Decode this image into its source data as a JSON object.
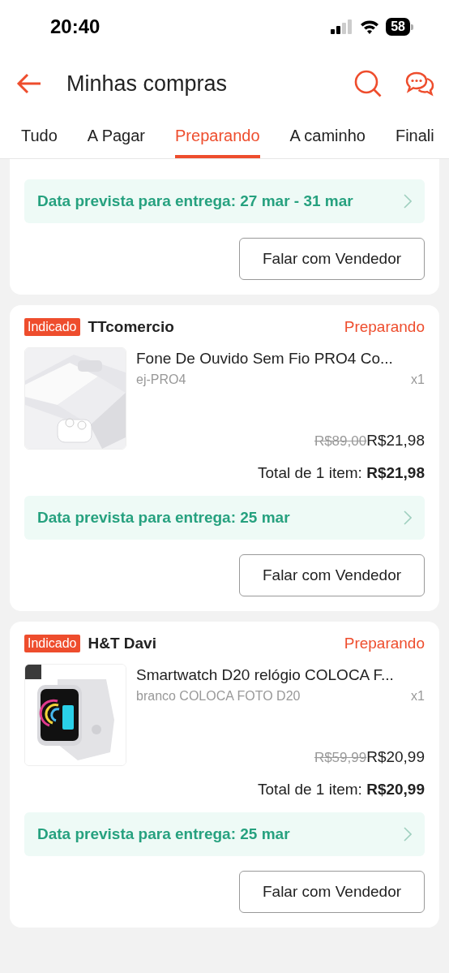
{
  "status_bar": {
    "time": "20:40",
    "battery": "58"
  },
  "header": {
    "title": "Minhas compras"
  },
  "tabs": [
    {
      "label": "Tudo",
      "selected": false
    },
    {
      "label": "A Pagar",
      "selected": false
    },
    {
      "label": "Preparando",
      "selected": true
    },
    {
      "label": "A caminho",
      "selected": false
    },
    {
      "label": "Finali",
      "selected": false
    }
  ],
  "orders": [
    {
      "delivery": "Data prevista para entrega: 27 mar - 31 mar",
      "button": "Falar com Vendedor"
    },
    {
      "badge": "Indicado",
      "shop": "TTcomercio",
      "status": "Preparando",
      "product": {
        "kind": "earbuds",
        "name": "Fone De Ouvido Sem Fio PRO4 Co...",
        "variant": "ej-PRO4",
        "quantity": "x1",
        "old_price": "R$89,00",
        "price": "R$21,98"
      },
      "total_label": "Total de 1 item:",
      "total": "R$21,98",
      "delivery": "Data prevista para entrega: 25 mar",
      "button": "Falar com Vendedor"
    },
    {
      "badge": "Indicado",
      "shop": "H&T Davi",
      "status": "Preparando",
      "product": {
        "kind": "watch",
        "name": "Smartwatch D20 relógio COLOCA F...",
        "variant": "branco COLOCA FOTO  D20",
        "quantity": "x1",
        "old_price": "R$59,99",
        "price": "R$20,99"
      },
      "total_label": "Total de 1 item:",
      "total": "R$20,99",
      "delivery": "Data prevista para entrega: 25 mar",
      "button": "Falar com Vendedor"
    }
  ]
}
